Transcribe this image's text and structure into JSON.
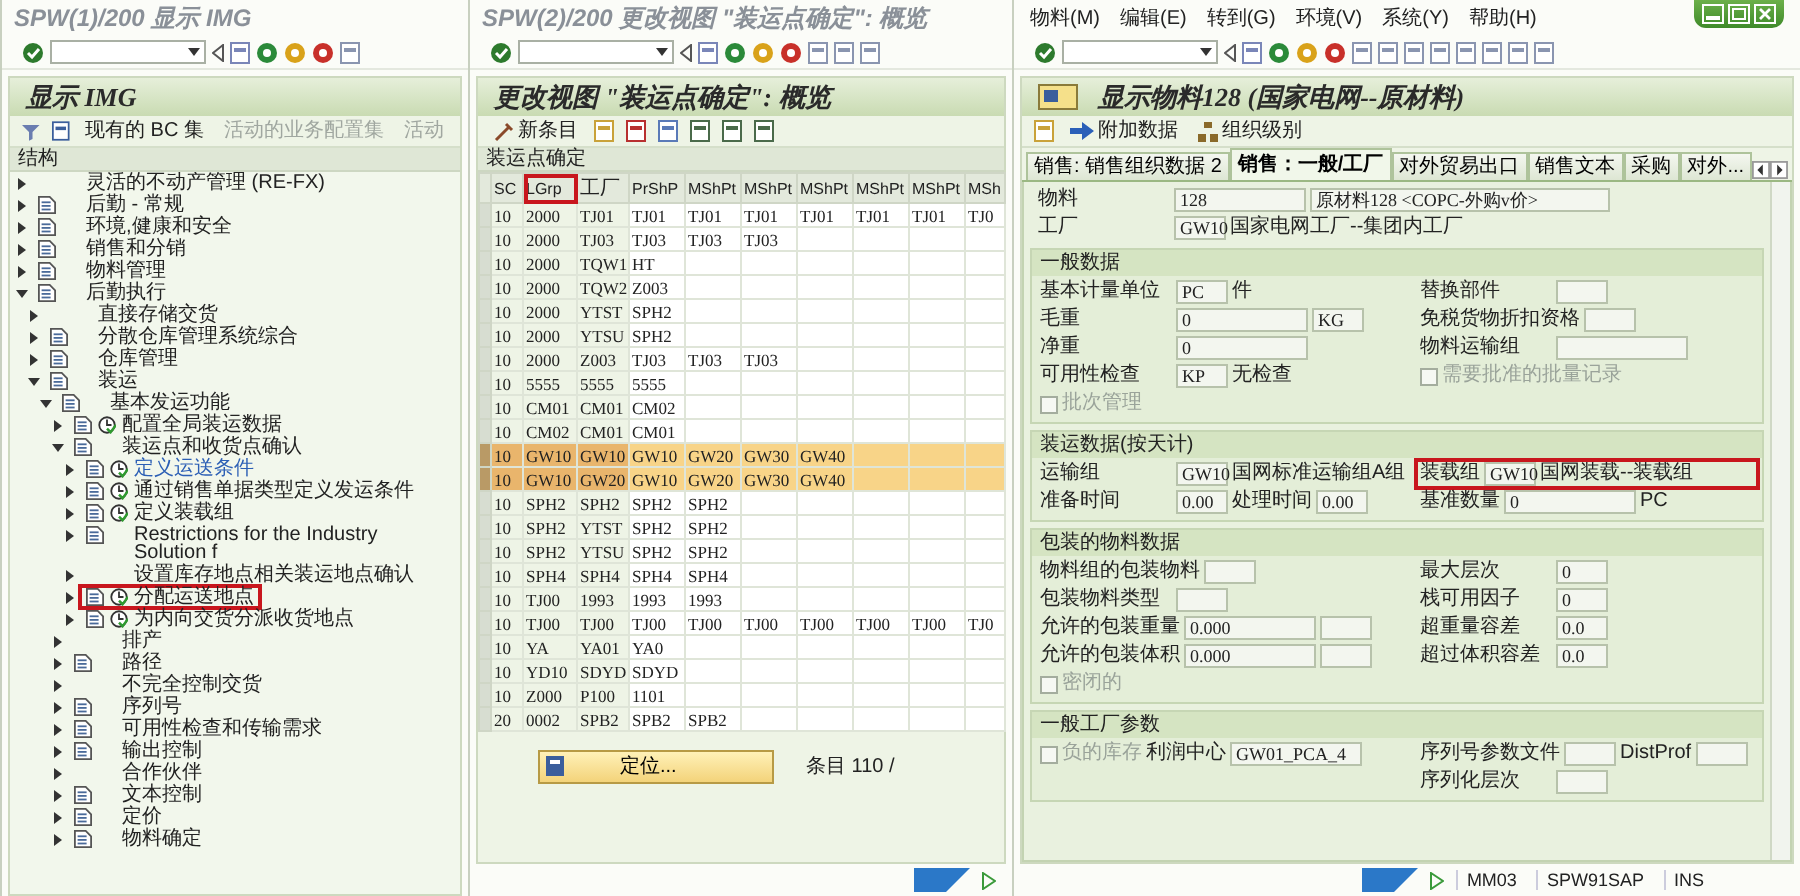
{
  "img_window": {
    "title": "SPW(1)/200 显示 IMG",
    "panel_title": "显示 IMG",
    "toolbar": [
      {
        "label": "现有的 BC 集",
        "disabled": false
      },
      {
        "label": "活动的业务配置集",
        "disabled": true
      },
      {
        "label": "活动",
        "disabled": true
      }
    ],
    "tree_header": "结构",
    "tree": [
      {
        "label": "灵活的不动产管理 (RE-FX)",
        "kind": "plain",
        "expanded": false,
        "marked": false,
        "link": false
      },
      {
        "label": "后勤 - 常规",
        "kind": "doc",
        "expanded": false,
        "marked": false,
        "link": false
      },
      {
        "label": "环境,健康和安全",
        "kind": "doc",
        "expanded": false,
        "marked": false,
        "link": false
      },
      {
        "label": "销售和分销",
        "kind": "doc",
        "expanded": false,
        "marked": false,
        "link": false
      },
      {
        "label": "物料管理",
        "kind": "doc",
        "expanded": false,
        "marked": false,
        "link": false
      },
      {
        "label": "后勤执行",
        "kind": "doc",
        "expanded": true,
        "marked": false,
        "link": false,
        "children": [
          {
            "label": "直接存储交货",
            "kind": "plain",
            "expanded": false,
            "marked": false,
            "link": false
          },
          {
            "label": "分散仓库管理系统综合",
            "kind": "doc",
            "expanded": false,
            "marked": false,
            "link": false
          },
          {
            "label": "仓库管理",
            "kind": "doc",
            "expanded": false,
            "marked": false,
            "link": false
          },
          {
            "label": "装运",
            "kind": "doc",
            "expanded": true,
            "marked": false,
            "link": false,
            "children": [
              {
                "label": "基本发运功能",
                "kind": "doc",
                "expanded": true,
                "marked": false,
                "link": false,
                "children": [
                  {
                    "label": "配置全局装运数据",
                    "kind": "activity",
                    "expanded": false,
                    "marked": false,
                    "link": false
                  },
                  {
                    "label": "装运点和收货点确认",
                    "kind": "doc",
                    "expanded": true,
                    "marked": false,
                    "link": false,
                    "children": [
                      {
                        "label": "定义运送条件",
                        "kind": "activity",
                        "expanded": false,
                        "marked": false,
                        "link": true
                      },
                      {
                        "label": "通过销售单据类型定义发运条件",
                        "kind": "activity",
                        "expanded": false,
                        "marked": false,
                        "link": false
                      },
                      {
                        "label": "定义装载组",
                        "kind": "activity",
                        "expanded": false,
                        "marked": false,
                        "link": false
                      },
                      {
                        "label": "Restrictions for the Industry Solution f",
                        "kind": "doc",
                        "expanded": false,
                        "marked": false,
                        "link": false
                      },
                      {
                        "label": "设置库存地点相关装运地点确认",
                        "kind": "plain",
                        "expanded": false,
                        "marked": false,
                        "link": false
                      },
                      {
                        "label": "分配运送地点",
                        "kind": "activity",
                        "expanded": false,
                        "marked": true,
                        "link": false
                      },
                      {
                        "label": "为内向交货分派收货地点",
                        "kind": "activity",
                        "expanded": false,
                        "marked": false,
                        "link": false
                      }
                    ]
                  },
                  {
                    "label": "排产",
                    "kind": "plain",
                    "expanded": false,
                    "marked": false,
                    "link": false
                  },
                  {
                    "label": "路径",
                    "kind": "doc",
                    "expanded": false,
                    "marked": false,
                    "link": false
                  },
                  {
                    "label": "不完全控制交货",
                    "kind": "plain",
                    "expanded": false,
                    "marked": false,
                    "link": false
                  },
                  {
                    "label": "序列号",
                    "kind": "doc",
                    "expanded": false,
                    "marked": false,
                    "link": false
                  },
                  {
                    "label": "可用性检查和传输需求",
                    "kind": "doc",
                    "expanded": false,
                    "marked": false,
                    "link": false
                  },
                  {
                    "label": "输出控制",
                    "kind": "doc",
                    "expanded": false,
                    "marked": false,
                    "link": false
                  },
                  {
                    "label": "合作伙伴",
                    "kind": "plain",
                    "expanded": false,
                    "marked": false,
                    "link": false
                  },
                  {
                    "label": "文本控制",
                    "kind": "doc",
                    "expanded": false,
                    "marked": false,
                    "link": false
                  },
                  {
                    "label": "定价",
                    "kind": "doc",
                    "expanded": false,
                    "marked": false,
                    "link": false
                  },
                  {
                    "label": "物料确定",
                    "kind": "doc",
                    "expanded": false,
                    "marked": false,
                    "link": false
                  }
                ]
              }
            ]
          }
        ]
      }
    ]
  },
  "view_window": {
    "title": "SPW(2)/200 更改视图 \"装运点确定\": 概览",
    "panel_title": "更改视图 \"装运点确定\": 概览",
    "new_entries": "新条目",
    "table_title": "装运点确定",
    "columns": [
      {
        "label": "SC",
        "marked": false
      },
      {
        "label": "LGrp",
        "marked": true
      },
      {
        "label": "工厂",
        "marked": false
      },
      {
        "label": "PrShP",
        "marked": false
      },
      {
        "label": "MShPt",
        "marked": false
      },
      {
        "label": "MShPt",
        "marked": false
      },
      {
        "label": "MShPt",
        "marked": false
      },
      {
        "label": "MShPt",
        "marked": false
      },
      {
        "label": "MShPt",
        "marked": false
      },
      {
        "label": "MSh",
        "marked": false
      }
    ],
    "rows": [
      {
        "selected": false,
        "cells": [
          "10",
          "2000",
          "TJ01",
          "TJ01",
          "TJ01",
          "TJ01",
          "TJ01",
          "TJ01",
          "TJ01",
          "TJ0"
        ]
      },
      {
        "selected": false,
        "cells": [
          "10",
          "2000",
          "TJ03",
          "TJ03",
          "TJ03",
          "TJ03"
        ]
      },
      {
        "selected": false,
        "cells": [
          "10",
          "2000",
          "TQW1",
          "HT"
        ]
      },
      {
        "selected": false,
        "cells": [
          "10",
          "2000",
          "TQW2",
          "Z003"
        ]
      },
      {
        "selected": false,
        "cells": [
          "10",
          "2000",
          "YTST",
          "SPH2"
        ]
      },
      {
        "selected": false,
        "cells": [
          "10",
          "2000",
          "YTSU",
          "SPH2"
        ]
      },
      {
        "selected": false,
        "cells": [
          "10",
          "2000",
          "Z003",
          "TJ03",
          "TJ03",
          "TJ03"
        ]
      },
      {
        "selected": false,
        "cells": [
          "10",
          "5555",
          "5555",
          "5555"
        ]
      },
      {
        "selected": false,
        "cells": [
          "10",
          "CM01",
          "CM01",
          "CM02"
        ]
      },
      {
        "selected": false,
        "cells": [
          "10",
          "CM02",
          "CM01",
          "CM01"
        ]
      },
      {
        "selected": true,
        "cells": [
          "10",
          "GW10",
          "GW10",
          "GW10",
          "GW20",
          "GW30",
          "GW40"
        ]
      },
      {
        "selected": true,
        "cells": [
          "10",
          "GW10",
          "GW20",
          "GW10",
          "GW20",
          "GW30",
          "GW40"
        ]
      },
      {
        "selected": false,
        "cells": [
          "10",
          "SPH2",
          "SPH2",
          "SPH2",
          "SPH2"
        ]
      },
      {
        "selected": false,
        "cells": [
          "10",
          "SPH2",
          "YTST",
          "SPH2",
          "SPH2"
        ]
      },
      {
        "selected": false,
        "cells": [
          "10",
          "SPH2",
          "YTSU",
          "SPH2",
          "SPH2"
        ]
      },
      {
        "selected": false,
        "cells": [
          "10",
          "SPH4",
          "SPH4",
          "SPH4",
          "SPH4"
        ]
      },
      {
        "selected": false,
        "cells": [
          "10",
          "TJ00",
          "1993",
          "1993",
          "1993"
        ]
      },
      {
        "selected": false,
        "cells": [
          "10",
          "TJ00",
          "TJ00",
          "TJ00",
          "TJ00",
          "TJ00",
          "TJ00",
          "TJ00",
          "TJ00",
          "TJ0"
        ]
      },
      {
        "selected": false,
        "cells": [
          "10",
          "YA",
          "YA01",
          "YA0"
        ]
      },
      {
        "selected": false,
        "cells": [
          "10",
          "YD10",
          "SDYD",
          "SDYD"
        ]
      },
      {
        "selected": false,
        "cells": [
          "10",
          "Z000",
          "P100",
          "1101"
        ]
      },
      {
        "selected": false,
        "cells": [
          "20",
          "0002",
          "SPB2",
          "SPB2",
          "SPB2"
        ]
      }
    ],
    "position_button": "定位...",
    "entries": "条目 110 /"
  },
  "material_window": {
    "menu": [
      "物料(M)",
      "编辑(E)",
      "转到(G)",
      "环境(V)",
      "系统(Y)",
      "帮助(H)"
    ],
    "title": "显示物料128 (国家电网--原材料)",
    "toolbar": [
      "附加数据",
      "组织级别"
    ],
    "tabs": [
      {
        "label": "销售: 销售组织数据 2",
        "selected": false
      },
      {
        "label": "销售：一般/工厂",
        "selected": true
      },
      {
        "label": "对外贸易出口",
        "selected": false
      },
      {
        "label": "销售文本",
        "selected": false
      },
      {
        "label": "采购",
        "selected": false
      },
      {
        "label": "对外...",
        "selected": false
      }
    ],
    "header_rows": [
      {
        "left": [
          {
            "kind": "label",
            "text": "物料"
          },
          {
            "kind": "field",
            "value": "128"
          },
          {
            "kind": "wide",
            "value": "原材料128 <COPC-外购v价>"
          },
          {
            "kind": "info"
          }
        ]
      },
      {
        "left": [
          {
            "kind": "label",
            "text": "工厂"
          },
          {
            "kind": "code",
            "value": "GW10"
          },
          {
            "kind": "text",
            "text": "国家电网工厂--集团内工厂"
          }
        ]
      }
    ],
    "sections": [
      {
        "title": "一般数据",
        "rows": [
          {
            "marked": false,
            "left": [
              {
                "kind": "label",
                "text": "基本计量单位"
              },
              {
                "kind": "code",
                "value": "PC"
              },
              {
                "kind": "text",
                "text": "件"
              }
            ],
            "right": [
              {
                "kind": "label",
                "text": "替换部件"
              },
              {
                "kind": "code"
              }
            ]
          },
          {
            "marked": false,
            "left": [
              {
                "kind": "label",
                "text": "毛重"
              },
              {
                "kind": "field",
                "value": "0"
              },
              {
                "kind": "code",
                "value": "KG"
              }
            ],
            "right": [
              {
                "kind": "label",
                "text": "免税货物折扣资格"
              },
              {
                "kind": "code"
              }
            ]
          },
          {
            "marked": false,
            "left": [
              {
                "kind": "label",
                "text": "净重"
              },
              {
                "kind": "field",
                "value": "0"
              }
            ],
            "right": [
              {
                "kind": "label",
                "text": "物料运输组"
              },
              {
                "kind": "field"
              }
            ]
          },
          {
            "marked": false,
            "left": [
              {
                "kind": "label",
                "text": "可用性检查"
              },
              {
                "kind": "code",
                "value": "KP"
              },
              {
                "kind": "text",
                "text": "无检查"
              }
            ],
            "right": [
              {
                "kind": "check",
                "text": "需要批准的批量记录",
                "checked": false,
                "disabled": true
              }
            ]
          },
          {
            "marked": false,
            "left": [
              {
                "kind": "check",
                "text": "批次管理",
                "checked": false,
                "disabled": true
              }
            ]
          }
        ]
      },
      {
        "title": "装运数据(按天计)",
        "rows": [
          {
            "marked": true,
            "left": [
              {
                "kind": "label",
                "text": "运输组"
              },
              {
                "kind": "code",
                "value": "GW10"
              },
              {
                "kind": "text",
                "text": "国网标准运输组A组"
              }
            ],
            "right": [
              {
                "kind": "text",
                "text": "装载组"
              },
              {
                "kind": "code",
                "value": "GW10"
              },
              {
                "kind": "text",
                "text": "国网装载--装载组"
              }
            ]
          },
          {
            "marked": false,
            "left": [
              {
                "kind": "label",
                "text": "准备时间"
              },
              {
                "kind": "code",
                "value": "0.00"
              },
              {
                "kind": "text",
                "text": "处理时间"
              },
              {
                "kind": "code",
                "value": "0.00"
              }
            ],
            "right": [
              {
                "kind": "text",
                "text": "基准数量"
              },
              {
                "kind": "field",
                "value": "0"
              },
              {
                "kind": "text",
                "text": "PC"
              }
            ]
          }
        ]
      },
      {
        "title": "包装的物料数据",
        "rows": [
          {
            "marked": false,
            "left": [
              {
                "kind": "label",
                "text": "物料组的包装物料"
              },
              {
                "kind": "code"
              }
            ],
            "right": [
              {
                "kind": "label",
                "text": "最大层次"
              },
              {
                "kind": "code",
                "value": "0"
              }
            ]
          },
          {
            "marked": false,
            "left": [
              {
                "kind": "label",
                "text": "包装物料类型"
              },
              {
                "kind": "code"
              }
            ],
            "right": [
              {
                "kind": "label",
                "text": "栈可用因子"
              },
              {
                "kind": "code",
                "value": "0"
              }
            ]
          },
          {
            "marked": false,
            "left": [
              {
                "kind": "label",
                "text": "允许的包装重量"
              },
              {
                "kind": "field",
                "value": "0.000"
              },
              {
                "kind": "code"
              }
            ],
            "right": [
              {
                "kind": "label",
                "text": "超重量容差"
              },
              {
                "kind": "code",
                "value": "0.0"
              }
            ]
          },
          {
            "marked": false,
            "left": [
              {
                "kind": "label",
                "text": "允许的包装体积"
              },
              {
                "kind": "field",
                "value": "0.000"
              },
              {
                "kind": "code"
              }
            ],
            "right": [
              {
                "kind": "label",
                "text": "超过体积容差"
              },
              {
                "kind": "code",
                "value": "0.0"
              }
            ]
          },
          {
            "marked": false,
            "left": [
              {
                "kind": "check",
                "text": "密闭的",
                "checked": false,
                "disabled": true
              }
            ]
          }
        ]
      },
      {
        "title": "一般工厂参数",
        "rows": [
          {
            "marked": false,
            "left": [
              {
                "kind": "check",
                "text": "负的库存",
                "checked": false,
                "disabled": true
              },
              {
                "kind": "text",
                "text": "利润中心"
              },
              {
                "kind": "field",
                "value": "GW01_PCA_4"
              }
            ],
            "right": [
              {
                "kind": "label",
                "text": "序列号参数文件"
              },
              {
                "kind": "code"
              },
              {
                "kind": "text",
                "text": "DistProf"
              },
              {
                "kind": "code"
              }
            ]
          },
          {
            "marked": false,
            "right": [
              {
                "kind": "label",
                "text": "序列化层次"
              },
              {
                "kind": "code"
              }
            ]
          }
        ]
      }
    ],
    "status": {
      "transaction": "MM03",
      "system": "SPW91SAP",
      "mode": "INS"
    }
  }
}
